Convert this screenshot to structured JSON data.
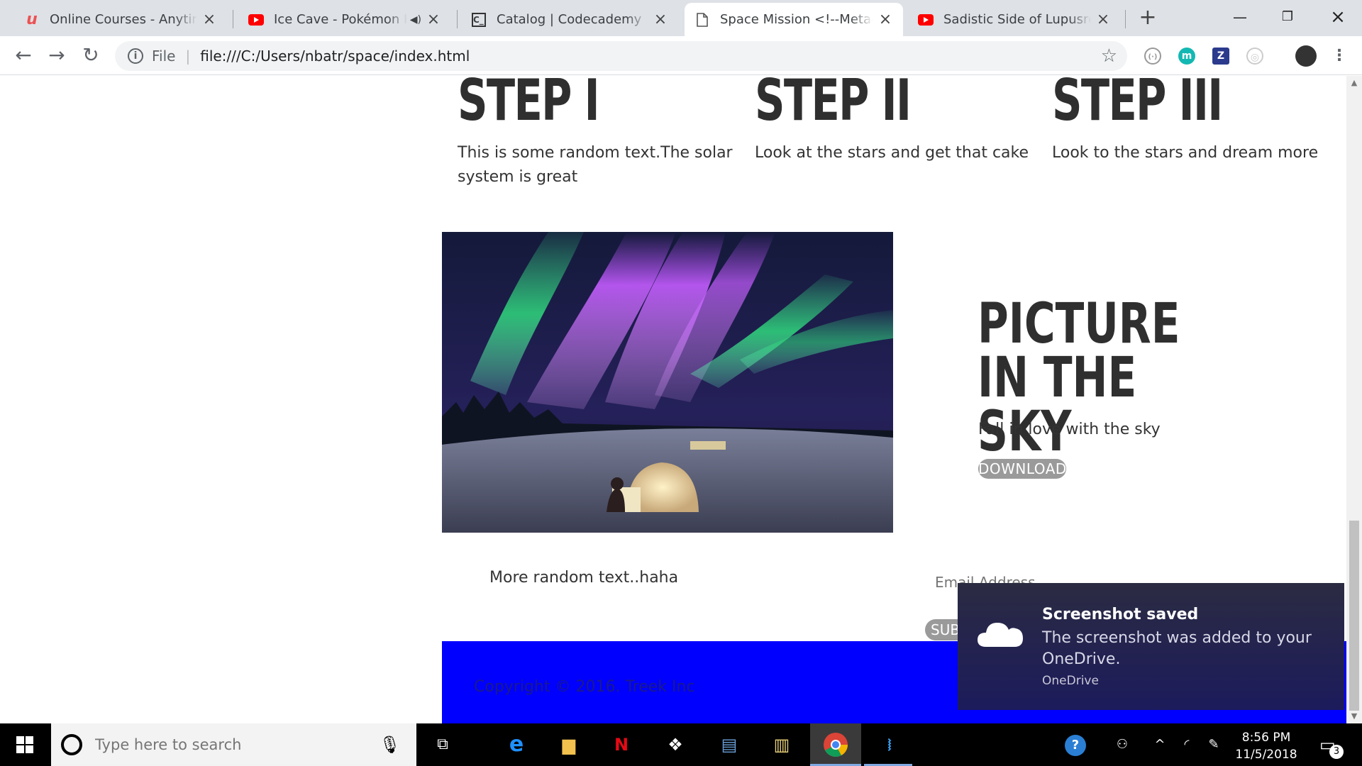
{
  "browser": {
    "tabs": [
      {
        "title": "Online Courses - Anytime, Anywhere | Udemy",
        "favicon": "udemy-icon"
      },
      {
        "title": "Ice Cave - Pokémon HeartGold & SoulSilver",
        "favicon": "youtube-icon",
        "audio": true
      },
      {
        "title": "Catalog | Codecademy",
        "favicon": "codecademy-icon"
      },
      {
        "title": "Space Mission <!--Meta-->",
        "favicon": "page-icon",
        "active": true
      },
      {
        "title": "Sadistic Side of Lupusregina",
        "favicon": "youtube-icon"
      }
    ],
    "omnibox": {
      "scheme_label": "File",
      "url": "file:///C:/Users/nbatr/space/index.html"
    }
  },
  "page": {
    "steps": [
      {
        "title": "STEP I",
        "text": "This is some random text.The solar system is great"
      },
      {
        "title": "STEP II",
        "text": "Look at the stars and get that cake"
      },
      {
        "title": "STEP III",
        "text": "Look to the stars and dream more"
      }
    ],
    "feature": {
      "title": "PICTURE IN THE SKY",
      "subtitle": "Fall in love with the sky",
      "button": "DOWNLOAD"
    },
    "more_text": "More random text..haha",
    "email_placeholder": "Email Address",
    "subscribe_button": "SUBSCRIBE",
    "footer_text": "Copyright © 2016. Treek Inc"
  },
  "toast": {
    "title": "Screenshot saved",
    "message": "The screenshot was added to your OneDrive.",
    "source": "OneDrive"
  },
  "taskbar": {
    "search_placeholder": "Type here to search",
    "time": "8:56 PM",
    "date": "11/5/2018",
    "notification_count": "3"
  },
  "colors": {
    "footer": "#0000ff",
    "toast": "#1c1b5c",
    "chrome_tabstrip": "#dee1e6"
  }
}
